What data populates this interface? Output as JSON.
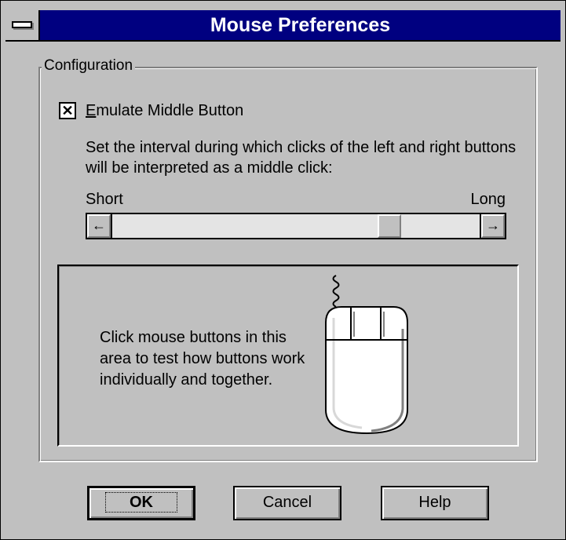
{
  "window": {
    "title": "Mouse Preferences"
  },
  "configuration": {
    "group_label": "Configuration",
    "emulate_middle": {
      "label_mnemonic": "E",
      "label_rest": "mulate Middle Button",
      "checked": true,
      "check_glyph": "✕"
    },
    "description": "Set the interval during which clicks of the left and right buttons will be interpreted as a middle click:",
    "slider": {
      "min_label": "Short",
      "max_label": "Long",
      "left_arrow": "←",
      "right_arrow": "→",
      "position_fraction": 0.77
    },
    "test_area": {
      "text": "Click mouse buttons in this area to test how buttons work individually and together.",
      "icon": "three-button-mouse-icon"
    }
  },
  "buttons": {
    "ok": "OK",
    "cancel": "Cancel",
    "help": "Help"
  },
  "colors": {
    "title_bar": "#000080",
    "face": "#c0c0c0"
  }
}
